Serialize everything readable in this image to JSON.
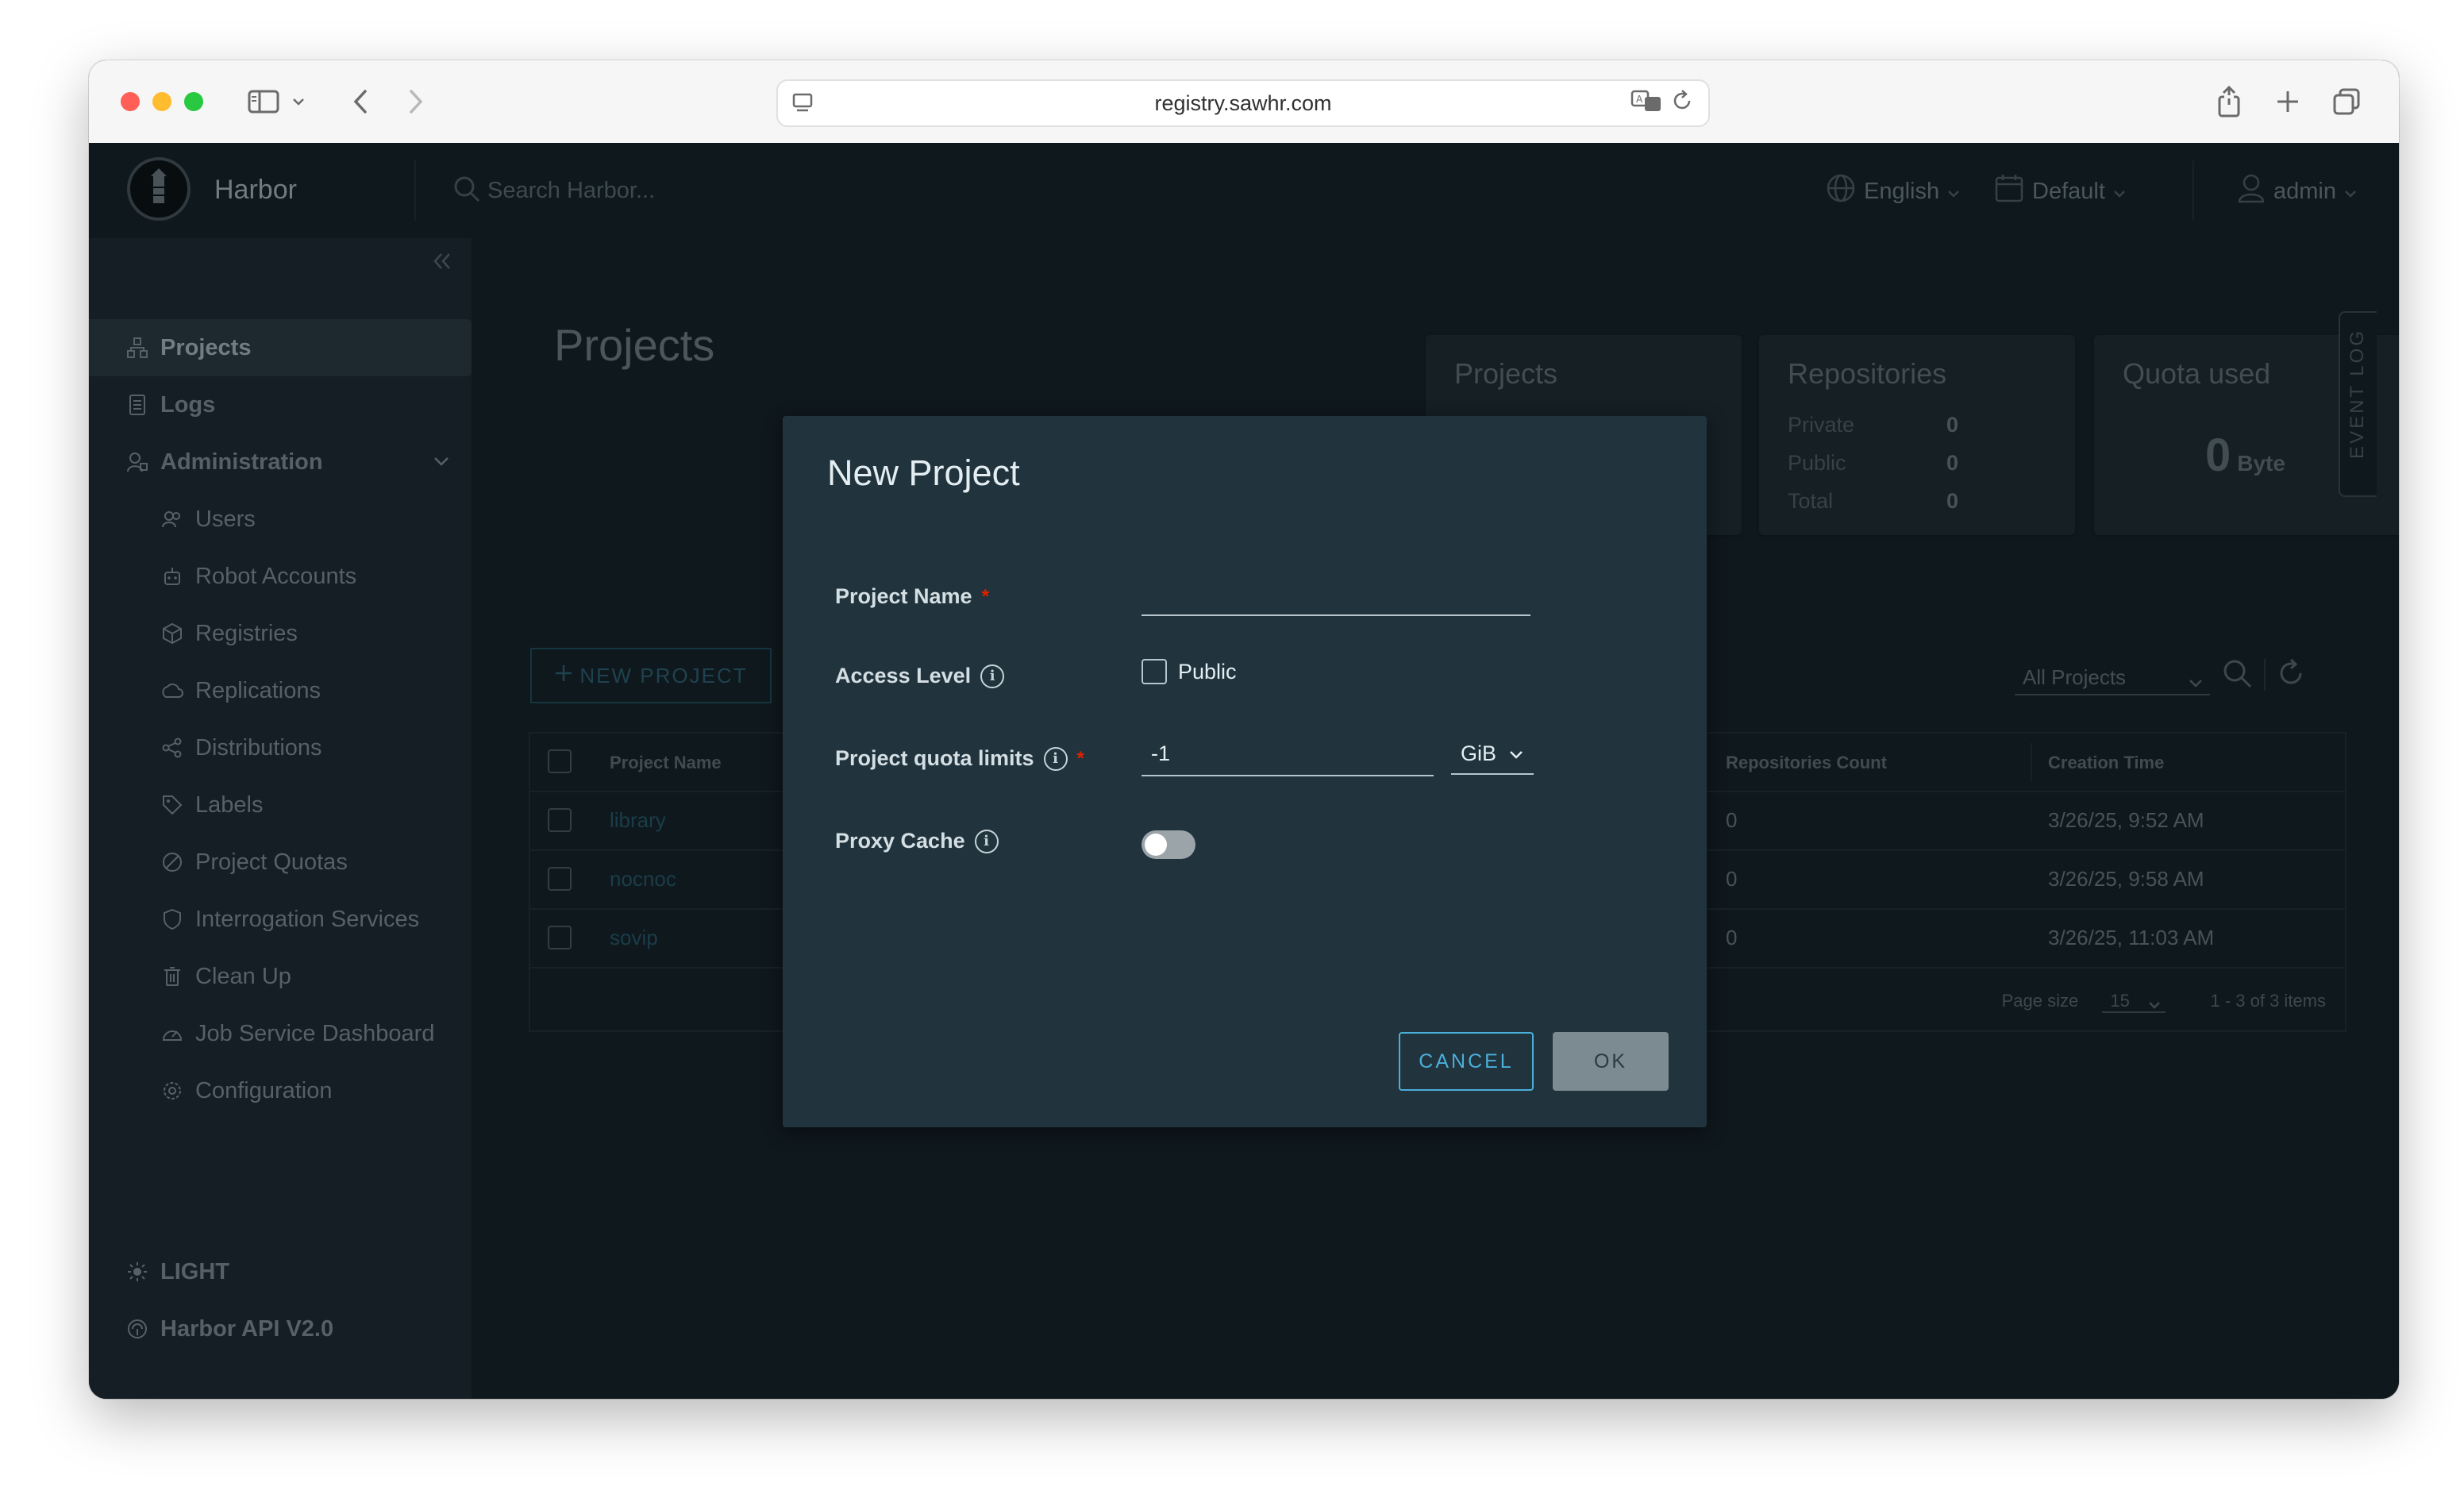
{
  "browser": {
    "url": "registry.sawhr.com"
  },
  "header": {
    "brand": "Harbor",
    "search_placeholder": "Search Harbor...",
    "language": "English",
    "theme": "Default",
    "user": "admin"
  },
  "sidebar": {
    "items": [
      {
        "label": "Projects",
        "icon": "projects-icon"
      },
      {
        "label": "Logs",
        "icon": "logs-icon"
      },
      {
        "label": "Administration",
        "icon": "administration-icon"
      },
      {
        "label": "Users",
        "icon": "users-icon"
      },
      {
        "label": "Robot Accounts",
        "icon": "robot-icon"
      },
      {
        "label": "Registries",
        "icon": "registries-icon"
      },
      {
        "label": "Replications",
        "icon": "replications-icon"
      },
      {
        "label": "Distributions",
        "icon": "distributions-icon"
      },
      {
        "label": "Labels",
        "icon": "tag-icon"
      },
      {
        "label": "Project Quotas",
        "icon": "quota-icon"
      },
      {
        "label": "Interrogation Services",
        "icon": "shield-icon"
      },
      {
        "label": "Clean Up",
        "icon": "trash-icon"
      },
      {
        "label": "Job Service Dashboard",
        "icon": "dashboard-icon"
      },
      {
        "label": "Configuration",
        "icon": "gear-icon"
      }
    ],
    "theme_toggle": "LIGHT",
    "api_link": "Harbor API V2.0"
  },
  "page": {
    "title": "Projects",
    "cards": {
      "projects_title": "Projects",
      "repositories_title": "Repositories",
      "repo_rows": [
        {
          "label": "Private",
          "value": "0"
        },
        {
          "label": "Public",
          "value": "0"
        },
        {
          "label": "Total",
          "value": "0"
        }
      ],
      "quota_title": "Quota used",
      "quota_value": "0",
      "quota_unit": "Byte"
    },
    "new_project_label": "NEW PROJECT",
    "filter_value": "All Projects",
    "table": {
      "headers": {
        "name": "Project Name",
        "repos": "Repositories Count",
        "created": "Creation Time"
      },
      "rows": [
        {
          "name": "library",
          "repos": "0",
          "created": "3/26/25, 9:52 AM"
        },
        {
          "name": "nocnoc",
          "repos": "0",
          "created": "3/26/25, 9:58 AM"
        },
        {
          "name": "sovip",
          "repos": "0",
          "created": "3/26/25, 11:03 AM"
        }
      ],
      "page_size_label": "Page size",
      "page_size_value": "15",
      "pagination": "1 - 3 of 3 items"
    },
    "event_log": "EVENT LOG"
  },
  "modal": {
    "title": "New Project",
    "project_name_label": "Project Name",
    "required_mark": "*",
    "project_name_value": "",
    "access_level_label": "Access Level",
    "public_label": "Public",
    "quota_label": "Project quota limits",
    "quota_value": "-1",
    "quota_unit": "GiB",
    "proxy_cache_label": "Proxy Cache",
    "cancel_label": "CANCEL",
    "ok_label": "OK",
    "info_glyph": "i"
  }
}
